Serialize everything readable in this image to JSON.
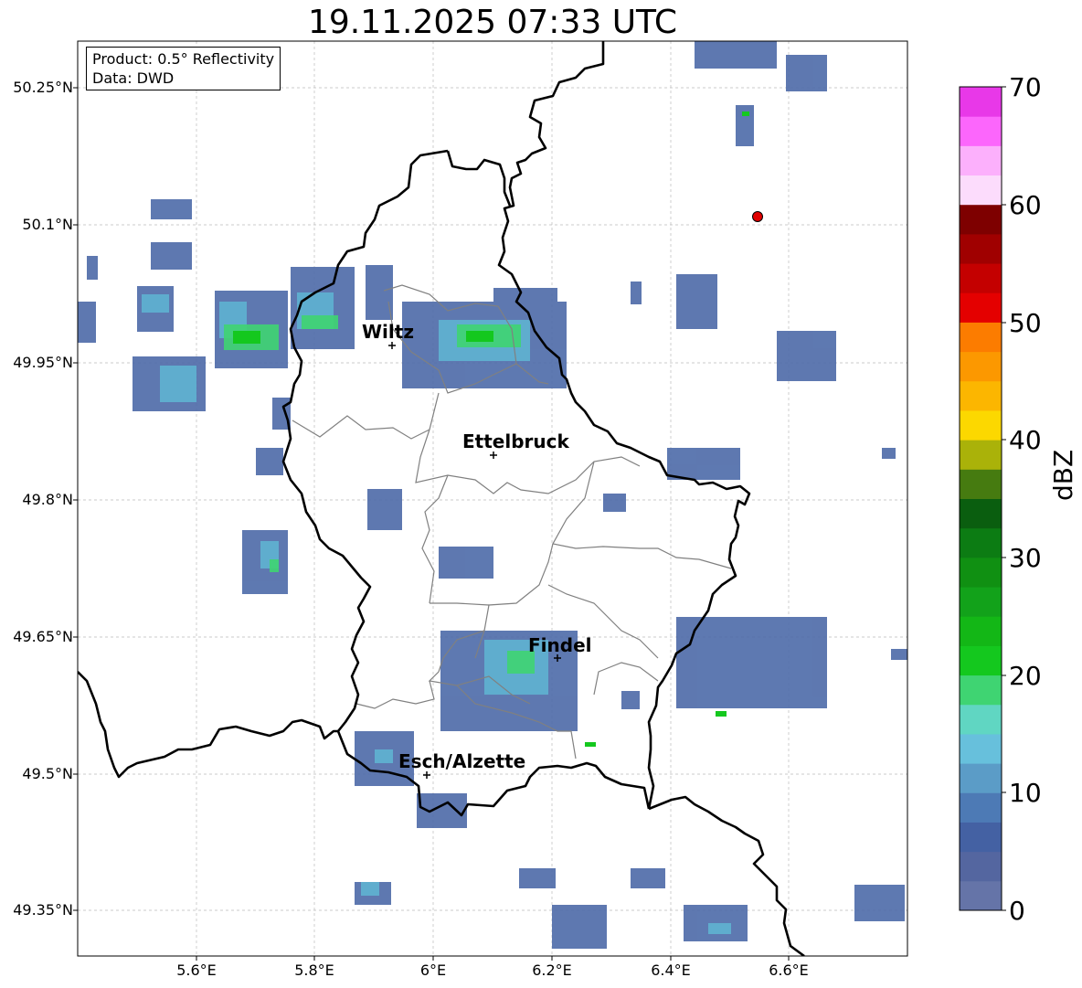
{
  "title": "19.11.2025 07:33 UTC",
  "info_box": {
    "line1": "Product: 0.5° Reflectivity",
    "line2": "Data: DWD"
  },
  "colorbar": {
    "label": "dBZ",
    "ticks": [
      "0",
      "10",
      "20",
      "30",
      "40",
      "50",
      "60",
      "70"
    ],
    "colors": [
      "#6574a8",
      "#5466a0",
      "#4461a3",
      "#4d7ab5",
      "#5b9cc7",
      "#67c0dc",
      "#60d6c2",
      "#3fd472",
      "#14c81e",
      "#13b716",
      "#12a21a",
      "#109012",
      "#0c7c13",
      "#0a5e0f",
      "#467b10",
      "#aab209",
      "#fcd800",
      "#fcb600",
      "#fc9800",
      "#fc7c00",
      "#e40000",
      "#c40000",
      "#a00000",
      "#7e0000",
      "#fcdcfc",
      "#fcb0fc",
      "#fc66fc",
      "#e838e8"
    ]
  },
  "axes": {
    "lat_ticks": [
      "50.25°N",
      "50.1°N",
      "49.95°N",
      "49.8°N",
      "49.65°N",
      "49.5°N",
      "49.35°N"
    ],
    "lon_ticks": [
      "5.6°E",
      "5.8°E",
      "6°E",
      "6.2°E",
      "6.4°E",
      "6.6°E"
    ]
  },
  "cities": [
    {
      "name": "Wiltz"
    },
    {
      "name": "Ettelbruck"
    },
    {
      "name": "Findel"
    },
    {
      "name": "Esch/Alzette"
    }
  ],
  "marker_color": "#e00000"
}
